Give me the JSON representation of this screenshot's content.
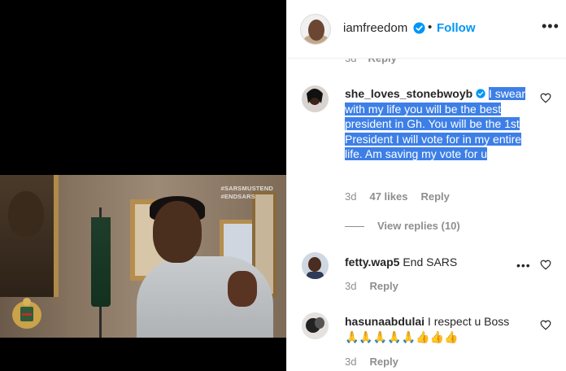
{
  "video": {
    "watermark": [
      "#SARSMUSTEND",
      "#ENDSARS"
    ]
  },
  "header": {
    "username": "iamfreedom",
    "separator": "•",
    "follow_label": "Follow",
    "more": "•••"
  },
  "partial_row": {
    "time": "3d",
    "reply": "Reply"
  },
  "comments": [
    {
      "username": "she_loves_stonebwoyb",
      "verified": true,
      "text": "I swear with my life you will be the best president in Gh. You will be the 1st President I will vote for in my entire life. Am saving my vote for u",
      "time": "3d",
      "likes": "47 likes",
      "reply": "Reply",
      "view_replies": "View replies (10)"
    },
    {
      "username": "fetty.wap5",
      "text": "End SARS",
      "time": "3d",
      "reply": "Reply",
      "more": "•••"
    },
    {
      "username": "hasunaabdulai",
      "text": "I respect u Boss",
      "emoji_text": "🙏🙏🙏🙏🙏👍👍👍",
      "time": "3d",
      "reply": "Reply"
    }
  ],
  "colors": {
    "accent": "#0095f6",
    "highlight": "#3d7fe6",
    "muted": "#8e8e8e"
  }
}
